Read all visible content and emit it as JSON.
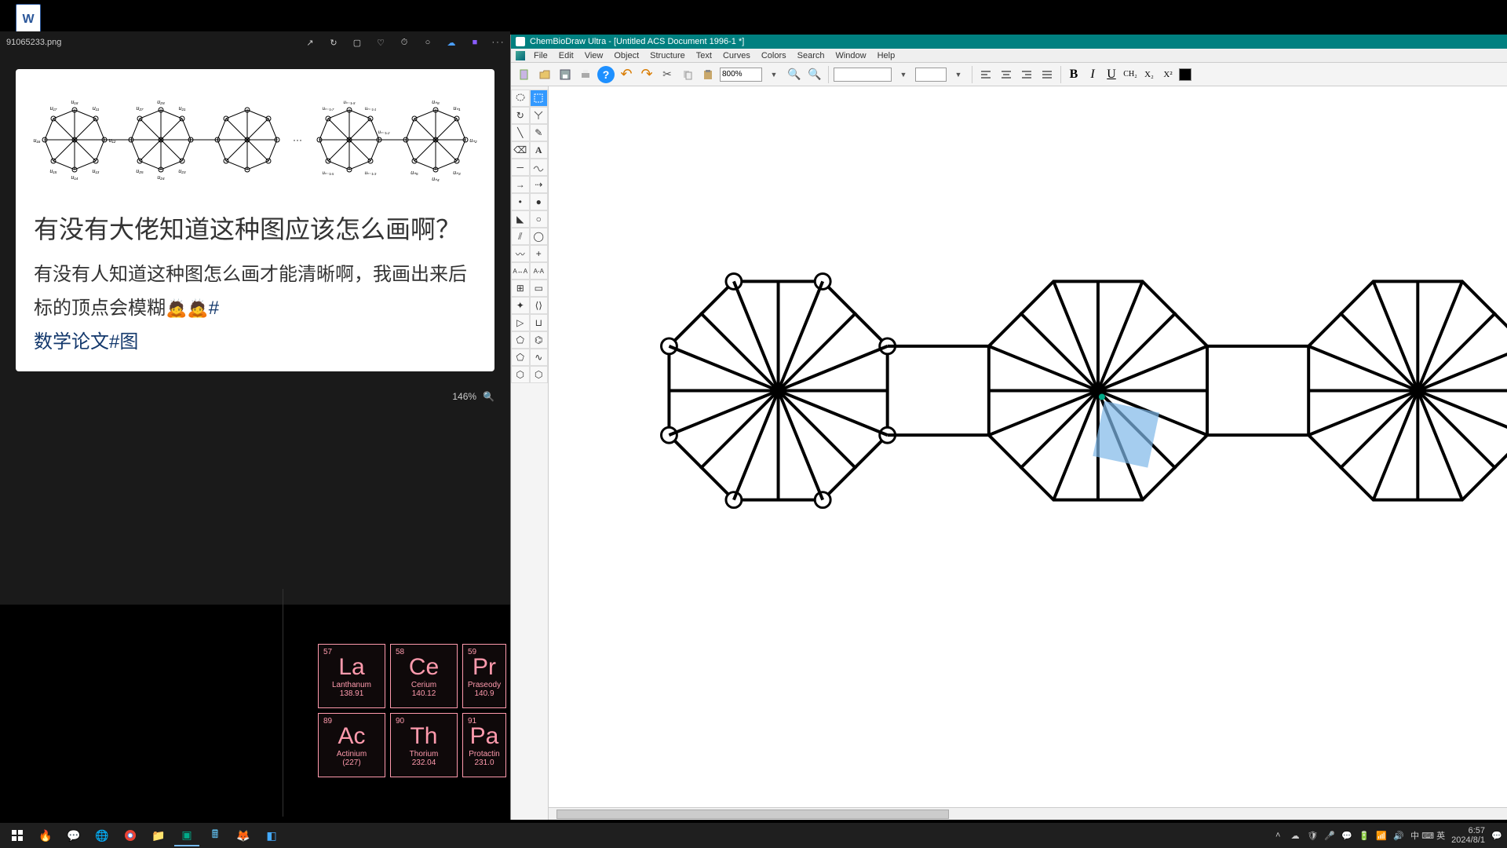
{
  "desktop": {
    "word_doc_label": ""
  },
  "viewer": {
    "filename": "91065233.png",
    "tools": [
      "↗",
      "↻",
      "▢",
      "♡",
      "⏱",
      "○",
      "☁",
      "■"
    ],
    "zoom_label": "146%",
    "post": {
      "title": "有没有大佬知道这种图应该怎么画啊？",
      "body_prefix": "有没有人知道这种图怎么画才能清晰啊，我画出来后标的顶点会模糊",
      "emoji": "🙇🙇",
      "hash_link": "#",
      "hashtag": "数学论文#图"
    }
  },
  "periodic": {
    "row1": [
      {
        "num": "57",
        "sym": "La",
        "name": "Lanthanum",
        "mass": "138.91"
      },
      {
        "num": "58",
        "sym": "Ce",
        "name": "Cerium",
        "mass": "140.12"
      },
      {
        "num": "59",
        "sym": "Pr",
        "name": "Praseody",
        "mass": "140.9"
      }
    ],
    "row2": [
      {
        "num": "89",
        "sym": "Ac",
        "name": "Actinium",
        "mass": "(227)"
      },
      {
        "num": "90",
        "sym": "Th",
        "name": "Thorium",
        "mass": "232.04"
      },
      {
        "num": "91",
        "sym": "Pa",
        "name": "Protactin",
        "mass": "231.0"
      }
    ]
  },
  "chemdraw": {
    "title": "ChemBioDraw Ultra - [Untitled ACS Document 1996-1 *]",
    "menus": [
      "File",
      "Edit",
      "View",
      "Object",
      "Structure",
      "Text",
      "Curves",
      "Colors",
      "Search",
      "Window",
      "Help"
    ],
    "zoom_value": "800%",
    "format_b": "B",
    "format_i": "I",
    "format_u": "U",
    "format_ch2": "CH₂",
    "format_sub": "X₂",
    "format_sup": "X²"
  },
  "taskbar": {
    "time": "6:57",
    "date": "2024/8/1",
    "ime": "中 ⌨ 英"
  }
}
